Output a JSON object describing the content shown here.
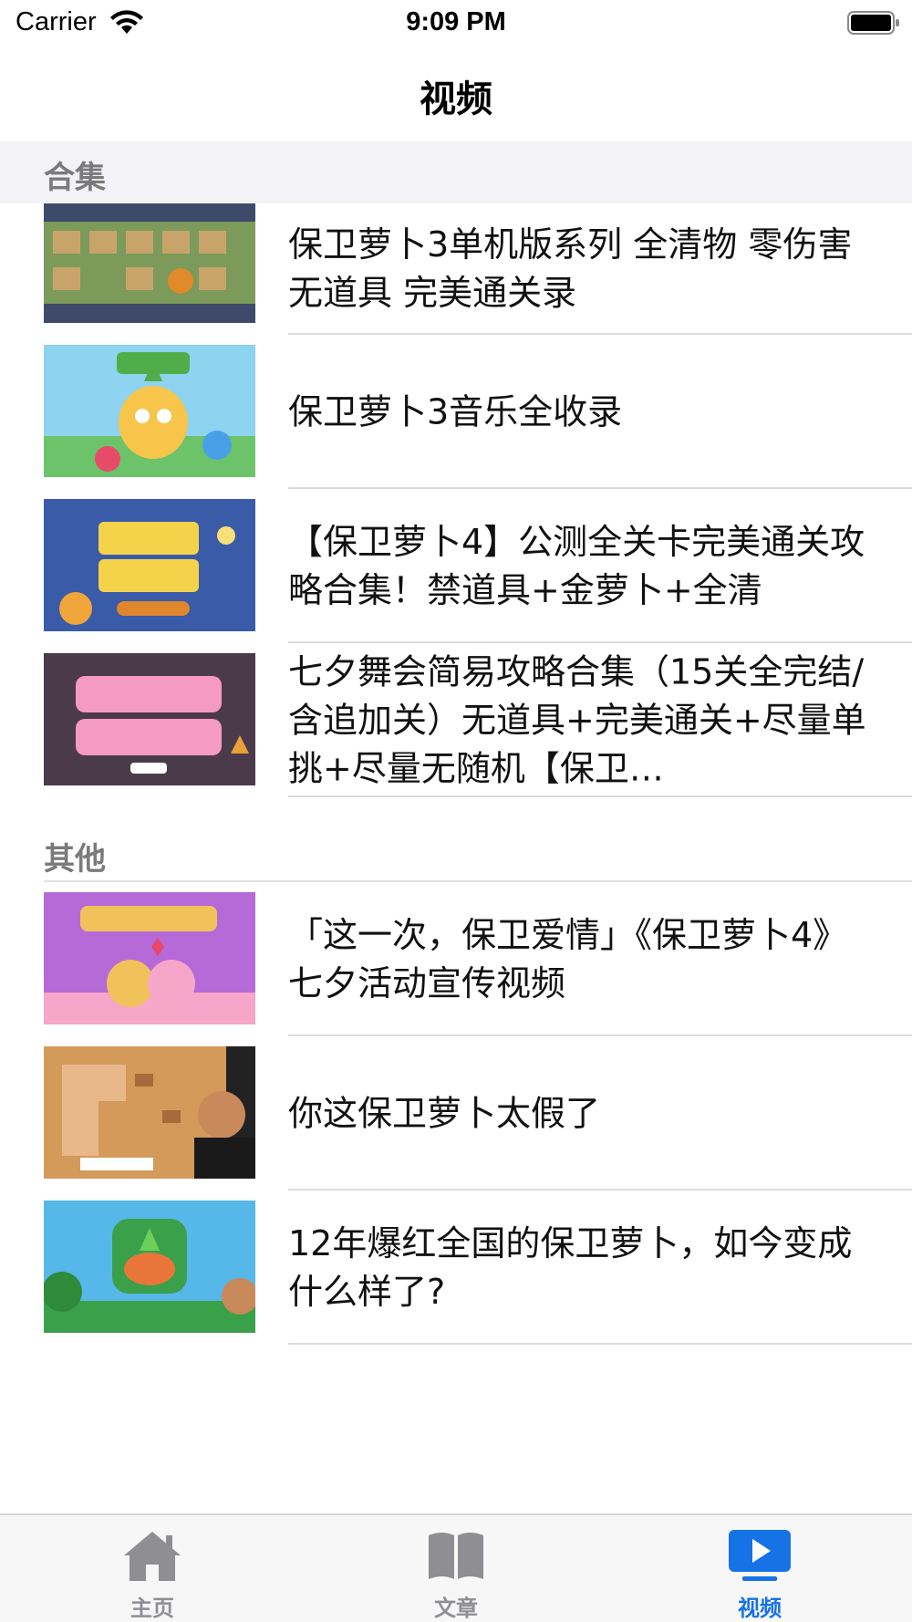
{
  "status_bar": {
    "carrier": "Carrier",
    "time": "9:09 PM"
  },
  "nav": {
    "title": "视频"
  },
  "sections": [
    {
      "header": "合集",
      "items": [
        {
          "title": "保卫萝卜3单机版系列  全清物 零伤害 无道具 完美通关录",
          "thumb_colors": [
            "#c9a46a",
            "#7c9a5a",
            "#3f4a6a"
          ]
        },
        {
          "title": "保卫萝卜3音乐全收录",
          "thumb_colors": [
            "#8ed3f0",
            "#f6c54a",
            "#6cc36a"
          ]
        },
        {
          "title": "【保卫萝卜4】公测全关卡完美通关攻略合集！禁道具+金萝卜+全清",
          "thumb_colors": [
            "#3a5ba8",
            "#f4d34a",
            "#e0862c"
          ]
        },
        {
          "title": "七夕舞会简易攻略合集（15关全完结/含追加关）无道具+完美通关+尽量单挑+尽量无随机【保卫…",
          "thumb_colors": [
            "#4a3a4a",
            "#f59ac2",
            "#ffffff"
          ]
        }
      ]
    },
    {
      "header": "其他",
      "items": [
        {
          "title": "「这一次，保卫爱情」《保卫萝卜4》七夕活动宣传视频",
          "thumb_colors": [
            "#b66ad8",
            "#f6a6c8",
            "#f2c25a"
          ]
        },
        {
          "title": "你这保卫萝卜太假了",
          "thumb_colors": [
            "#d49a5a",
            "#a86a3a",
            "#222222"
          ]
        },
        {
          "title": "12年爆红全国的保卫萝卜，如今变成什么样了?",
          "thumb_colors": [
            "#56b8e8",
            "#3aa04a",
            "#e8763a"
          ]
        }
      ]
    }
  ],
  "tabs": [
    {
      "label": "主页",
      "icon": "home-icon",
      "active": false
    },
    {
      "label": "文章",
      "icon": "book-icon",
      "active": false
    },
    {
      "label": "视频",
      "icon": "play-icon",
      "active": true
    }
  ],
  "colors": {
    "accent": "#1673e6",
    "inactive": "#8e8e93",
    "section_bg": "#f2f2f7"
  }
}
